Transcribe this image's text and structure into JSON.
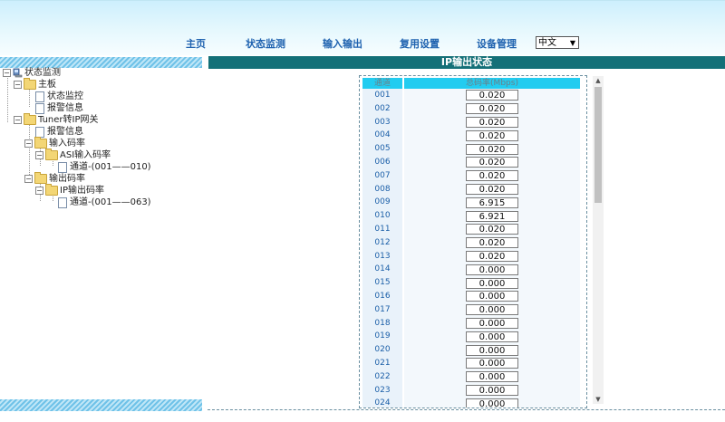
{
  "nav": {
    "items": [
      "主页",
      "状态监测",
      "输入输出",
      "复用设置",
      "设备管理"
    ],
    "language": "中文"
  },
  "tree": {
    "root": "状态监测",
    "mainboard": "主板",
    "status_monitor": "状态监控",
    "alarm_info_1": "报警信息",
    "tuner_gateway": "Tuner转IP网关",
    "alarm_info_2": "报警信息",
    "input_rate": "输入码率",
    "asi_input_rate": "ASI输入码率",
    "channel_range_1": "通道-(001——010)",
    "output_rate": "输出码率",
    "ip_output_rate": "IP输出码率",
    "channel_range_2": "通道-(001——063)"
  },
  "main": {
    "title": "IP输出状态",
    "col_channel": "通道",
    "col_rate": "总码率(Mbps)",
    "rows": [
      {
        "ch": "001",
        "v": "0.020"
      },
      {
        "ch": "002",
        "v": "0.020"
      },
      {
        "ch": "003",
        "v": "0.020"
      },
      {
        "ch": "004",
        "v": "0.020"
      },
      {
        "ch": "005",
        "v": "0.020"
      },
      {
        "ch": "006",
        "v": "0.020"
      },
      {
        "ch": "007",
        "v": "0.020"
      },
      {
        "ch": "008",
        "v": "0.020"
      },
      {
        "ch": "009",
        "v": "6.915"
      },
      {
        "ch": "010",
        "v": "6.921"
      },
      {
        "ch": "011",
        "v": "0.020"
      },
      {
        "ch": "012",
        "v": "0.020"
      },
      {
        "ch": "013",
        "v": "0.020"
      },
      {
        "ch": "014",
        "v": "0.000"
      },
      {
        "ch": "015",
        "v": "0.000"
      },
      {
        "ch": "016",
        "v": "0.000"
      },
      {
        "ch": "017",
        "v": "0.000"
      },
      {
        "ch": "018",
        "v": "0.000"
      },
      {
        "ch": "019",
        "v": "0.000"
      },
      {
        "ch": "020",
        "v": "0.000"
      },
      {
        "ch": "021",
        "v": "0.000"
      },
      {
        "ch": "022",
        "v": "0.000"
      },
      {
        "ch": "023",
        "v": "0.000"
      },
      {
        "ch": "024",
        "v": "0.000"
      }
    ]
  },
  "colors": {
    "title_bar": "#147078",
    "header_cell": "#22ccf0",
    "nav_text": "#2063b0"
  }
}
